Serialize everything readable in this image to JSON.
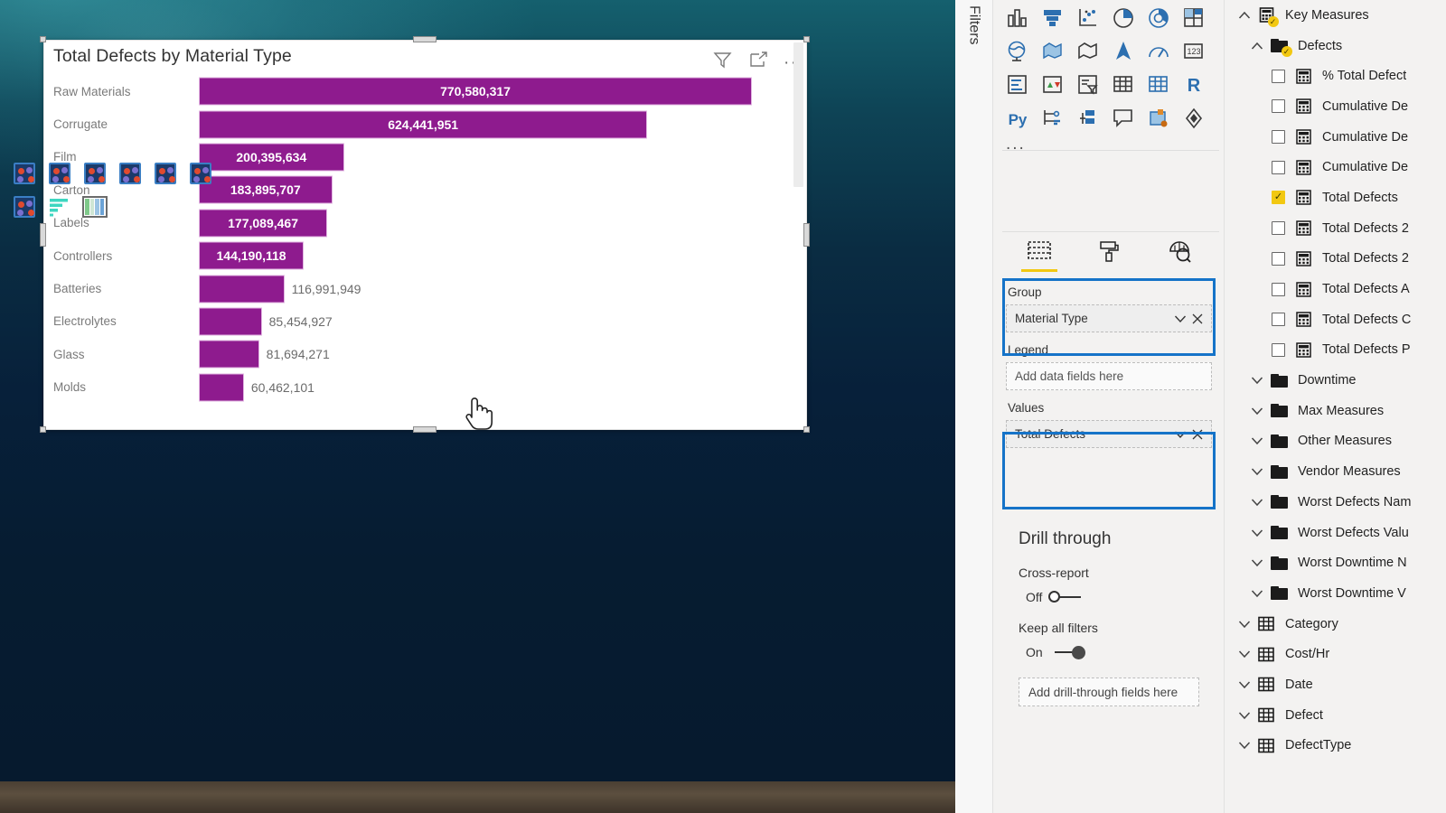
{
  "visual": {
    "title": "Total Defects by Material Type",
    "header_icons": [
      {
        "name": "filter-icon",
        "label": "Filter"
      },
      {
        "name": "focus-mode-icon",
        "label": "Focus mode"
      },
      {
        "name": "more-options-icon",
        "label": "More options"
      }
    ]
  },
  "chart_data": {
    "type": "bar",
    "orientation": "horizontal",
    "title": "Total Defects by Material Type",
    "xlabel": "",
    "ylabel": "",
    "grid": false,
    "legend": "none",
    "categories": [
      "Raw Materials",
      "Corrugate",
      "Film",
      "Carton",
      "Labels",
      "Controllers",
      "Batteries",
      "Electrolytes",
      "Glass",
      "Molds"
    ],
    "values": [
      770580317,
      624441951,
      200395634,
      183895707,
      177089467,
      144190118,
      116991949,
      85454927,
      81694271,
      60462101
    ],
    "value_labels": [
      "770,580,317",
      "624,441,951",
      "200,395,634",
      "183,895,707",
      "177,089,467",
      "144,190,118",
      "116,991,949",
      "85,454,927",
      "81,694,271",
      "60,462,101"
    ],
    "label_position": [
      "inside",
      "inside",
      "inside",
      "inside",
      "inside",
      "inside",
      "outside",
      "outside",
      "outside",
      "outside"
    ],
    "bar_color": "#8E1B8E",
    "xlim": [
      0,
      770580317
    ]
  },
  "filters_rail": {
    "label": "Filters"
  },
  "visualizations": {
    "gallery_icons": [
      "stacked-bar-chart-icon",
      "stacked-column-chart-icon",
      "scatter-chart-icon",
      "pie-chart-icon",
      "donut-chart-icon",
      "treemap-icon",
      "map-icon",
      "filled-map-icon",
      "shape-map-icon",
      "arcgis-map-icon",
      "gauge-icon",
      "card-icon",
      "multi-row-card-icon",
      "kpi-icon",
      "slicer-icon",
      "table-icon",
      "matrix-icon",
      "r-script-visual-icon",
      "python-visual-icon",
      "decomposition-tree-icon",
      "key-influencers-icon",
      "smart-narrative-icon",
      "paginated-report-icon",
      "power-apps-icon"
    ],
    "more_icons_label": "...",
    "custom_icons": [
      "custom-visual-icon",
      "custom-visual-icon",
      "custom-visual-icon",
      "custom-visual-icon",
      "custom-visual-icon",
      "custom-visual-icon",
      "custom-visual-icon",
      "bar-list-visual-icon",
      "stream-visual-icon"
    ],
    "tabs": [
      {
        "name": "fields-tab",
        "icon": "fields-build-icon",
        "active": true
      },
      {
        "name": "format-tab",
        "icon": "paint-roller-icon",
        "active": false
      },
      {
        "name": "analytics-tab",
        "icon": "analytics-magnifier-icon",
        "active": false
      }
    ]
  },
  "wells": {
    "group": {
      "title": "Group",
      "field": "Material Type",
      "dropdown_icon": "chevron-down-icon",
      "remove_icon": "remove-field-icon",
      "highlighted": true
    },
    "legend": {
      "title": "Legend",
      "placeholder": "Add data fields here",
      "highlighted": false
    },
    "values": {
      "title": "Values",
      "field": "Total Defects",
      "dropdown_icon": "chevron-down-icon",
      "remove_icon": "remove-field-icon",
      "highlighted": true
    }
  },
  "drill_through": {
    "title": "Drill through",
    "cross_report": {
      "label": "Cross-report",
      "state": "Off",
      "on": false
    },
    "keep_all_filters": {
      "label": "Keep all filters",
      "state": "On",
      "on": true
    },
    "drop_placeholder": "Add drill-through fields here"
  },
  "fields": {
    "items": [
      {
        "label": "Key Measures",
        "type": "model-table",
        "indent": 0,
        "expanded": true,
        "checkbox": null,
        "badge": true
      },
      {
        "label": "Defects",
        "type": "folder",
        "indent": 1,
        "expanded": true,
        "checkbox": null,
        "badge": true
      },
      {
        "label": "% Total Defect",
        "type": "measure",
        "indent": 2,
        "expanded": null,
        "checkbox": false,
        "badge": false
      },
      {
        "label": "Cumulative De",
        "type": "measure",
        "indent": 2,
        "expanded": null,
        "checkbox": false,
        "badge": false
      },
      {
        "label": "Cumulative De",
        "type": "measure",
        "indent": 2,
        "expanded": null,
        "checkbox": false,
        "badge": false
      },
      {
        "label": "Cumulative De",
        "type": "measure",
        "indent": 2,
        "expanded": null,
        "checkbox": false,
        "badge": false
      },
      {
        "label": "Total Defects",
        "type": "measure",
        "indent": 2,
        "expanded": null,
        "checkbox": true,
        "badge": false
      },
      {
        "label": "Total Defects 2",
        "type": "measure",
        "indent": 2,
        "expanded": null,
        "checkbox": false,
        "badge": false
      },
      {
        "label": "Total Defects 2",
        "type": "measure",
        "indent": 2,
        "expanded": null,
        "checkbox": false,
        "badge": false
      },
      {
        "label": "Total Defects A",
        "type": "measure",
        "indent": 2,
        "expanded": null,
        "checkbox": false,
        "badge": false
      },
      {
        "label": "Total Defects C",
        "type": "measure",
        "indent": 2,
        "expanded": null,
        "checkbox": false,
        "badge": false
      },
      {
        "label": "Total Defects P",
        "type": "measure",
        "indent": 2,
        "expanded": null,
        "checkbox": false,
        "badge": false
      },
      {
        "label": "Downtime",
        "type": "folder",
        "indent": 1,
        "expanded": false,
        "checkbox": null,
        "badge": false
      },
      {
        "label": "Max Measures",
        "type": "folder",
        "indent": 1,
        "expanded": false,
        "checkbox": null,
        "badge": false
      },
      {
        "label": "Other Measures",
        "type": "folder",
        "indent": 1,
        "expanded": false,
        "checkbox": null,
        "badge": false
      },
      {
        "label": "Vendor Measures",
        "type": "folder",
        "indent": 1,
        "expanded": false,
        "checkbox": null,
        "badge": false
      },
      {
        "label": "Worst Defects Nam",
        "type": "folder",
        "indent": 1,
        "expanded": false,
        "checkbox": null,
        "badge": false
      },
      {
        "label": "Worst Defects Valu",
        "type": "folder",
        "indent": 1,
        "expanded": false,
        "checkbox": null,
        "badge": false
      },
      {
        "label": "Worst Downtime N",
        "type": "folder",
        "indent": 1,
        "expanded": false,
        "checkbox": null,
        "badge": false
      },
      {
        "label": "Worst Downtime V",
        "type": "folder",
        "indent": 1,
        "expanded": false,
        "checkbox": null,
        "badge": false
      },
      {
        "label": "Category",
        "type": "table",
        "indent": 0,
        "expanded": false,
        "checkbox": null,
        "badge": false
      },
      {
        "label": "Cost/Hr",
        "type": "table",
        "indent": 0,
        "expanded": false,
        "checkbox": null,
        "badge": false
      },
      {
        "label": "Date",
        "type": "table",
        "indent": 0,
        "expanded": false,
        "checkbox": null,
        "badge": false
      },
      {
        "label": "Defect",
        "type": "table",
        "indent": 0,
        "expanded": false,
        "checkbox": null,
        "badge": false
      },
      {
        "label": "DefectType",
        "type": "table",
        "indent": 0,
        "expanded": false,
        "checkbox": null,
        "badge": false
      }
    ]
  }
}
